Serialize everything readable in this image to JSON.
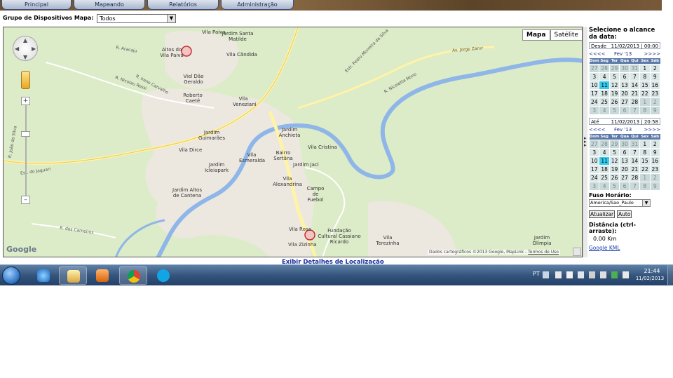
{
  "nav": {
    "tabs": [
      {
        "label": "Principal"
      },
      {
        "label": "Mapeando"
      },
      {
        "label": "Relatórios"
      },
      {
        "label": "Administração"
      }
    ]
  },
  "device_group": {
    "label": "Grupo de Dispositivos Mapa:",
    "selected": "Todos"
  },
  "map": {
    "type_buttons": {
      "map": "Mapa",
      "satellite": "Satélite"
    },
    "logo": "Google",
    "credit": "Dados cartográficos ©2013 Google, MapLink -",
    "terms": "Termos de Uso",
    "places": [
      "Vila Paiva",
      "Jardim Santa Matilde",
      "Altos do Vila Paiva",
      "Vila Cândida",
      "Viel Dão Geraldo",
      "Roberto Caeté",
      "Vila Veneziani",
      "Jardim Guimarães",
      "Jardim Anchieta",
      "Vila Dirce",
      "Vila Esmeralda",
      "Bairro Sertãna",
      "Vila Cristina",
      "Jardim Jaci",
      "Jardim Icleiapark",
      "Vila Alexandrina",
      "Campo de Fuebol",
      "Jardim Altos de Cantena",
      "Vila Rosa",
      "Fundação Cultural Cassiano Ricardo",
      "Vila Zizinha",
      "Vila Terezinha",
      "Jardim Olímpia"
    ],
    "roads": [
      "R. Ireno Carvalho",
      "Est. do Jaguari",
      "Estr. Pedro Morreira da Silva",
      "R. Nicolau Rossi",
      "R. Aracaju",
      "R. dos Carneiros",
      "R. Nicoletta Nono",
      "Av. Jorge Zarur",
      "R. João da Silva"
    ],
    "markers": [
      "red-pin-north",
      "red-pin-south"
    ]
  },
  "panel": {
    "title": "Selecione o alcance da data:",
    "from": {
      "label": "Desde",
      "value": "11/02/2013 | 00:00"
    },
    "to": {
      "label": "Até",
      "value": "11/02/2013 | 20:58"
    },
    "calendar": {
      "prev": "<<<<",
      "month": "Fev '13",
      "next": ">>>>",
      "weekdays": [
        "Dom",
        "Seg",
        "Ter",
        "Qua",
        "Qui",
        "Sex",
        "Sáb"
      ],
      "weeks": [
        [
          "27",
          "28",
          "29",
          "30",
          "31",
          "1",
          "2"
        ],
        [
          "3",
          "4",
          "5",
          "6",
          "7",
          "8",
          "9"
        ],
        [
          "10",
          "11",
          "12",
          "13",
          "14",
          "15",
          "16"
        ],
        [
          "17",
          "18",
          "19",
          "20",
          "21",
          "22",
          "23"
        ],
        [
          "24",
          "25",
          "26",
          "27",
          "28",
          "1",
          "2"
        ],
        [
          "3",
          "4",
          "5",
          "6",
          "7",
          "8",
          "9"
        ]
      ],
      "selected_day": "11"
    },
    "timezone_label": "Fuso Horário:",
    "timezone_value": "America/Sao_Paulo",
    "update_button": "Atualizar",
    "auto_button": "Auto",
    "distance_label": "Distância (ctrl-arraste):",
    "distance_value": "0.00 Km",
    "kml_link": "Google KML"
  },
  "details_link": "Exibir Detalhes de Localização",
  "taskbar": {
    "apps": [
      "ie-icon",
      "explorer-icon",
      "media-player-icon",
      "chrome-icon",
      "skype-icon"
    ],
    "lang": "PT",
    "time": "21:44",
    "date": "11/02/2013"
  },
  "colors": {
    "map_land": "#dcebc8",
    "river": "#8eb6e8",
    "road": "#fff3a8",
    "calendar_header": "#5c7aa8",
    "selected_day": "#33ccee",
    "link": "#1a2f9c"
  }
}
